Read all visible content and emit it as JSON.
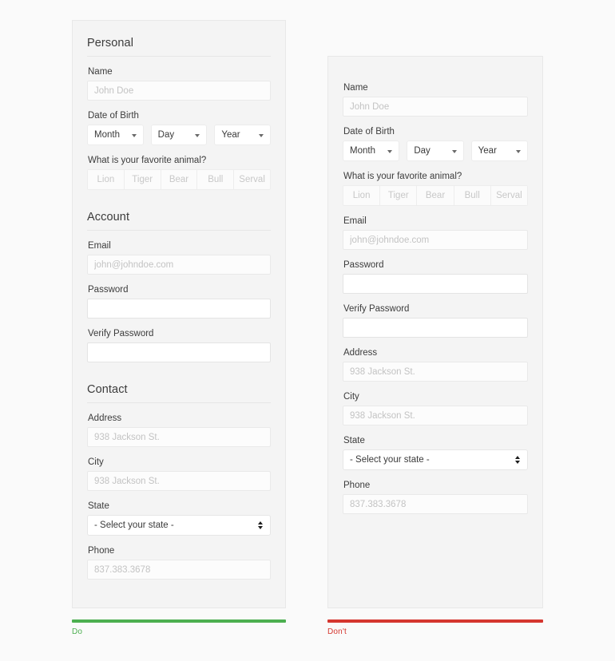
{
  "page": {
    "background": "#fafafa",
    "panel_background": "#f4f4f4"
  },
  "do_column": {
    "verdict": {
      "label": "Do",
      "color": "#4caf50"
    },
    "sections": [
      {
        "heading": "Personal",
        "fields": [
          {
            "type": "text",
            "label": "Name",
            "value": "",
            "placeholder": "John Doe"
          },
          {
            "type": "dob",
            "label": "Date of Birth",
            "selects": [
              {
                "value": "Month"
              },
              {
                "value": "Day"
              },
              {
                "value": "Year"
              }
            ]
          },
          {
            "type": "segmented",
            "label": "What is your favorite animal?",
            "options": [
              "Lion",
              "Tiger",
              "Bear",
              "Bull",
              "Serval"
            ]
          }
        ]
      },
      {
        "heading": "Account",
        "fields": [
          {
            "type": "text",
            "label": "Email",
            "value": "",
            "placeholder": "john@johndoe.com"
          },
          {
            "type": "password",
            "label": "Password",
            "value": "",
            "placeholder": ""
          },
          {
            "type": "password",
            "label": "Verify Password",
            "value": "",
            "placeholder": ""
          }
        ]
      },
      {
        "heading": "Contact",
        "fields": [
          {
            "type": "text",
            "label": "Address",
            "value": "",
            "placeholder": "938 Jackson St."
          },
          {
            "type": "text",
            "label": "City",
            "value": "",
            "placeholder": "938 Jackson St."
          },
          {
            "type": "select",
            "label": "State",
            "value": "- Select your state -"
          },
          {
            "type": "text",
            "label": "Phone",
            "value": "",
            "placeholder": "837.383.3678"
          }
        ]
      }
    ]
  },
  "dont_column": {
    "verdict": {
      "label": "Don't",
      "color": "#d5362f"
    },
    "sections": [
      {
        "heading": "",
        "fields": [
          {
            "type": "text",
            "label": "Name",
            "value": "",
            "placeholder": "John Doe"
          },
          {
            "type": "dob",
            "label": "Date of Birth",
            "selects": [
              {
                "value": "Month"
              },
              {
                "value": "Day"
              },
              {
                "value": "Year"
              }
            ]
          },
          {
            "type": "segmented",
            "label": "What is your favorite animal?",
            "options": [
              "Lion",
              "Tiger",
              "Bear",
              "Bull",
              "Serval"
            ]
          },
          {
            "type": "text",
            "label": "Email",
            "value": "",
            "placeholder": "john@johndoe.com"
          },
          {
            "type": "password",
            "label": "Password",
            "value": "",
            "placeholder": ""
          },
          {
            "type": "password",
            "label": "Verify Password",
            "value": "",
            "placeholder": ""
          },
          {
            "type": "text",
            "label": "Address",
            "value": "",
            "placeholder": "938 Jackson St."
          },
          {
            "type": "text",
            "label": "City",
            "value": "",
            "placeholder": "938 Jackson St."
          },
          {
            "type": "select",
            "label": "State",
            "value": "- Select your state -"
          },
          {
            "type": "text",
            "label": "Phone",
            "value": "",
            "placeholder": "837.383.3678"
          }
        ]
      }
    ]
  }
}
